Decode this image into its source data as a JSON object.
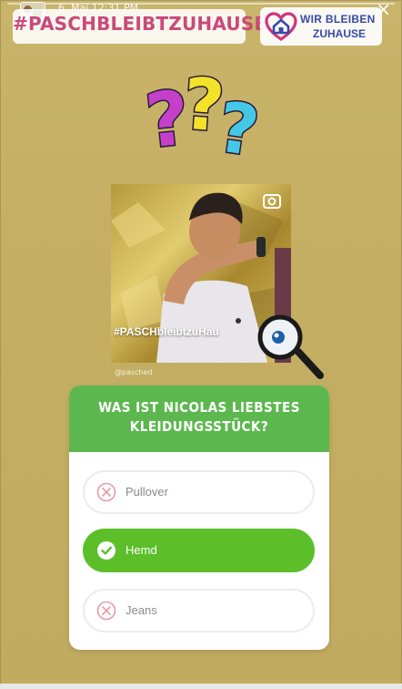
{
  "header": {
    "date": "6. Mai 12:31 PM",
    "close": "×"
  },
  "stickers": {
    "hashtag": "#PASCHBLEIBTZUHAUSE",
    "wir_bleiben_line1": "WIR BLEIBEN",
    "wir_bleiben_line2": "ZUHAUSE"
  },
  "photo": {
    "caption": "#PASCHbleibtzuHau",
    "credit": "@pasched"
  },
  "quiz": {
    "question": "WAS IST NICOLAS LIEBSTES KLEIDUNGSSTÜCK?",
    "options": [
      {
        "label": "Pullover",
        "state": "wrong"
      },
      {
        "label": "Hemd",
        "state": "correct"
      },
      {
        "label": "Jeans",
        "state": "wrong"
      }
    ]
  },
  "colors": {
    "quiz_header": "#5cb84e",
    "correct": "#5cbf2a",
    "wrong_icon": "#e89aa3",
    "hashtag_text": "#c94a7a",
    "background": "#c9b46a"
  },
  "icons": {
    "question_marks": "question-marks-icon",
    "magnifier": "magnifier-icon",
    "wrong": "x-circle-icon",
    "correct": "check-circle-icon"
  }
}
